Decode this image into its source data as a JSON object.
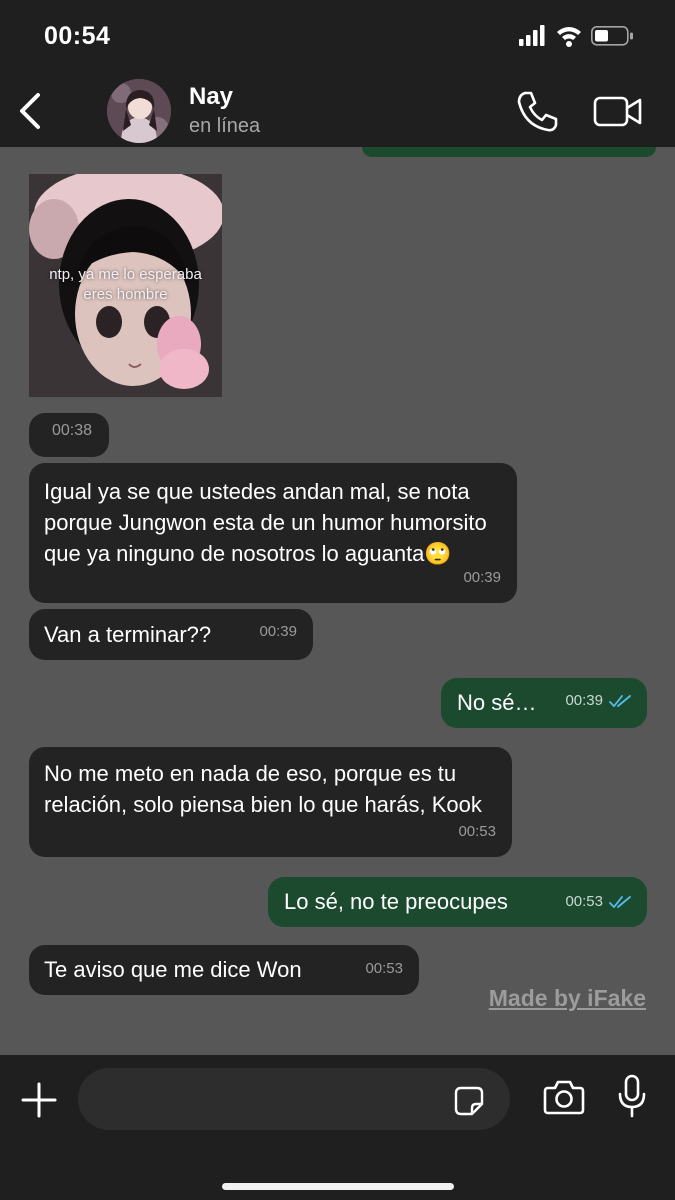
{
  "status_bar": {
    "time": "00:54"
  },
  "header": {
    "contact_name": "Nay",
    "contact_status": "en línea"
  },
  "image_message": {
    "caption_line1": "ntp, ya me lo esperaba",
    "caption_line2": "eres hombre",
    "time": "00:38"
  },
  "messages": [
    {
      "direction": "in",
      "text": "Igual ya se que ustedes andan mal, se nota porque Jungwon esta de un humor humorsito que ya ninguno de nosotros lo aguanta🙄",
      "time": "00:39"
    },
    {
      "direction": "in",
      "text": "Van a terminar??",
      "time": "00:39"
    },
    {
      "direction": "out",
      "text": "No sé…",
      "time": "00:39"
    },
    {
      "direction": "in",
      "text": "No me meto en nada de eso, porque es tu relación, solo piensa bien lo que harás, Kook",
      "time": "00:53"
    },
    {
      "direction": "out",
      "text": "Lo sé, no te preocupes",
      "time": "00:53"
    },
    {
      "direction": "in",
      "text": "Te aviso que me dice Won",
      "time": "00:53"
    }
  ],
  "watermark": "Made by iFake",
  "composer": {
    "placeholder": ""
  },
  "icons": {
    "back": "chevron-left-icon",
    "call": "phone-icon",
    "video": "video-camera-icon",
    "plus": "plus-icon",
    "sticker": "sticker-icon",
    "camera": "camera-icon",
    "mic": "microphone-icon",
    "read": "double-check-icon"
  },
  "colors": {
    "background": "#575757",
    "bars": "#1f1f1f",
    "incoming_bubble": "#232323",
    "outgoing_bubble": "#1b4a2f",
    "read_tick": "#53bdeb"
  }
}
